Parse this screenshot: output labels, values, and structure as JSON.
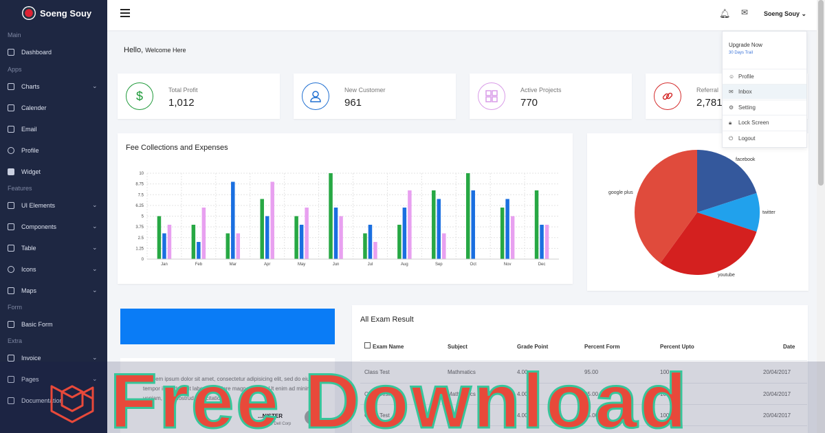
{
  "brand": {
    "name": "Soeng Souy"
  },
  "sidebar": {
    "sections": {
      "main": "Main",
      "apps": "Apps",
      "features": "Features",
      "form": "Form",
      "extra": "Extra"
    },
    "items": [
      {
        "label": "Dashboard",
        "icon": "dashboard-icon"
      },
      {
        "label": "Charts",
        "icon": "chart-icon"
      },
      {
        "label": "Calender",
        "icon": "calendar-icon"
      },
      {
        "label": "Email",
        "icon": "mail-icon"
      },
      {
        "label": "Profile",
        "icon": "user-icon"
      },
      {
        "label": "Widget",
        "icon": "grid-icon"
      },
      {
        "label": "UI Elements",
        "icon": "ui-icon"
      },
      {
        "label": "Components",
        "icon": "components-icon"
      },
      {
        "label": "Table",
        "icon": "table-icon"
      },
      {
        "label": "Icons",
        "icon": "heart-icon"
      },
      {
        "label": "Maps",
        "icon": "map-icon"
      },
      {
        "label": "Basic Form",
        "icon": "form-icon"
      },
      {
        "label": "Invoice",
        "icon": "invoice-icon"
      },
      {
        "label": "Pages",
        "icon": "pages-icon"
      },
      {
        "label": "Documentation",
        "icon": "doc-icon"
      }
    ]
  },
  "topbar": {
    "user": "Soeng Souy"
  },
  "greeting": {
    "hello": "Hello,",
    "sub": "Welcome Here"
  },
  "stats": [
    {
      "label": "Total Profit",
      "value": "1,012",
      "color": "#1f9a3a",
      "icon": "$"
    },
    {
      "label": "New Customer",
      "value": "961",
      "color": "#1f6fd1",
      "icon": "👤"
    },
    {
      "label": "Active Projects",
      "value": "770",
      "color": "#d99be8",
      "icon": "▦"
    },
    {
      "label": "Referral",
      "value": "2,781",
      "color": "#d42b2b",
      "icon": "∞"
    }
  ],
  "dropdown": {
    "upgrade": "Upgrade Now",
    "trail": "30 Days Trail",
    "items": [
      "Profile",
      "Inbox",
      "Setting",
      "Lock Screen",
      "Logout"
    ]
  },
  "chart_data": [
    {
      "type": "bar",
      "title": "Fee Collections and Expenses",
      "categories": [
        "Jan",
        "Feb",
        "Mar",
        "Apr",
        "May",
        "Jun",
        "Jul",
        "Aug",
        "Sep",
        "Oct",
        "Nov",
        "Dec"
      ],
      "ylim": [
        0,
        10
      ],
      "yticks": [
        "0",
        "1.25",
        "2.5",
        "3.75",
        "5",
        "6.25",
        "7.5",
        "8.75",
        "10"
      ],
      "series": [
        {
          "color": "#27a844",
          "values": [
            5,
            4,
            3,
            7,
            5,
            10,
            3,
            4,
            8,
            10,
            6,
            8
          ]
        },
        {
          "color": "#1a6fe0",
          "values": [
            3,
            2,
            9,
            5,
            4,
            6,
            4,
            6,
            7,
            8,
            7,
            4
          ]
        },
        {
          "color": "#e8a0f0",
          "values": [
            4,
            6,
            3,
            9,
            6,
            5,
            2,
            8,
            3,
            0,
            5,
            4
          ]
        }
      ]
    },
    {
      "type": "pie",
      "labels": [
        "facebook",
        "twitter",
        "youtube",
        "google plus"
      ],
      "values": [
        20,
        10,
        30,
        40
      ],
      "colors": [
        "#34589c",
        "#21a1ec",
        "#d4201f",
        "#e04b3c"
      ]
    }
  ],
  "table": {
    "title": "All Exam Result",
    "headers": [
      "Exam Name",
      "Subject",
      "Grade Point",
      "Percent Form",
      "Percent Upto",
      "Date"
    ],
    "rows": [
      [
        "Class Test",
        "Mathmatics",
        "4.00",
        "95.00",
        "100",
        "20/04/2017"
      ],
      [
        "Class Test",
        "Mathmatics",
        "4.00",
        "95.00",
        "100",
        "20/04/2017"
      ],
      [
        "Class Test",
        "Engl...",
        "4.00",
        "95.00",
        "100",
        "20/04/2017"
      ]
    ]
  },
  "testimonial": {
    "text": "Lorem ipsum dolor sit amet, consectetur adipisicing elit, sed do eiusmod tempor incididunt ut labore et dolore magna aliqua. Ut enim ad minim veniam, quis nostrud exercitation",
    "name": "...NISTER",
    "role": "...nder-Ceo, Dell Corp"
  },
  "banner": {
    "text": "Free Download"
  }
}
